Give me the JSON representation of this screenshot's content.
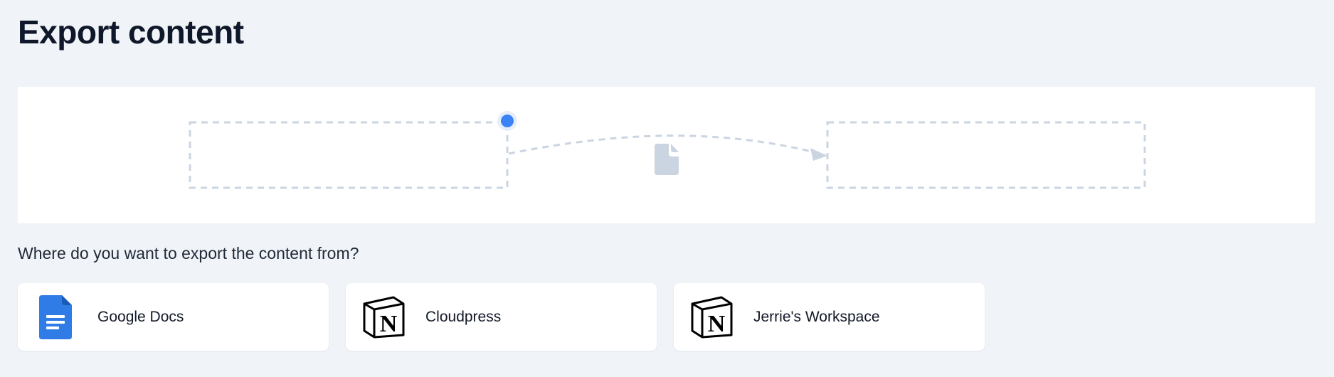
{
  "page": {
    "title": "Export content",
    "question": "Where do you want to export the content from?"
  },
  "colors": {
    "accent": "#3b82f6",
    "dashed_outline": "#cbd5e1",
    "doc_icon": "#cbd5e1",
    "google_docs_blue": "#2f7ce6"
  },
  "flow": {
    "source_box_icon": "empty-source-slot",
    "transfer_icon": "document-icon",
    "destination_box_icon": "empty-destination-slot"
  },
  "sources": [
    {
      "label": "Google Docs",
      "icon": "google-docs-icon"
    },
    {
      "label": "Cloudpress",
      "icon": "notion-icon"
    },
    {
      "label": "Jerrie's Workspace",
      "icon": "notion-icon"
    }
  ]
}
